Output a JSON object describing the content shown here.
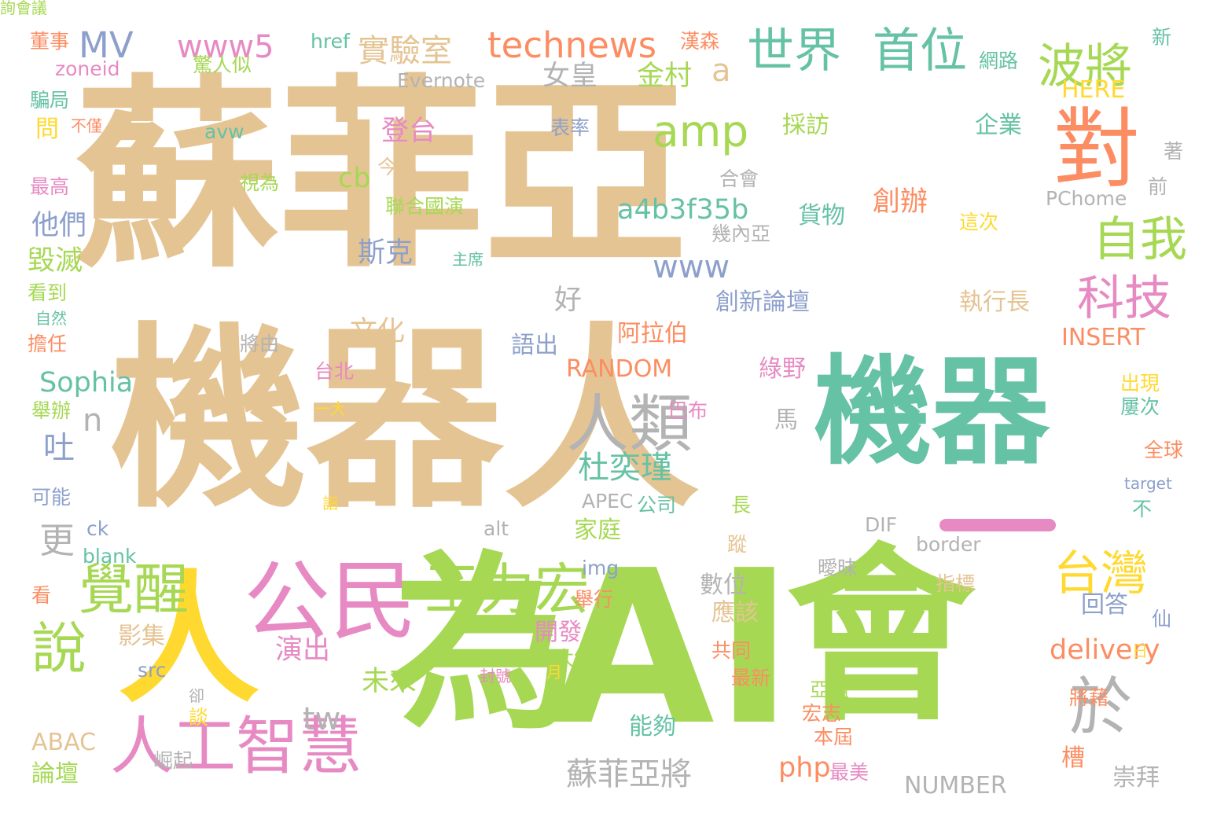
{
  "palette": {
    "tan": "#e5c494",
    "green": "#a6d854",
    "teal": "#66c2a5",
    "pink": "#e78ac3",
    "yellow": "#ffd92f",
    "grey": "#b3b3b3",
    "orange": "#fc8d62",
    "blue": "#8da0cb"
  },
  "words": [
    {
      "text": "蘇菲亞",
      "color": "tan"
    },
    {
      "text": "機器人",
      "color": "tan"
    },
    {
      "text": "機器",
      "color": "teal"
    },
    {
      "text": "AI",
      "color": "green"
    },
    {
      "text": "會",
      "color": "green"
    },
    {
      "text": "為",
      "color": "green"
    },
    {
      "text": "人",
      "color": "yellow"
    },
    {
      "text": "公民",
      "color": "pink"
    },
    {
      "text": "對",
      "color": "orange"
    },
    {
      "text": "人類",
      "color": "grey"
    },
    {
      "text": "於",
      "color": "grey"
    },
    {
      "text": "人工智慧",
      "color": "pink"
    },
    {
      "text": "王力宏",
      "color": "green"
    },
    {
      "text": "覺醒",
      "color": "green"
    },
    {
      "text": "說",
      "color": "green"
    },
    {
      "text": "世界",
      "color": "teal"
    },
    {
      "text": "首位",
      "color": "teal"
    },
    {
      "text": "波將",
      "color": "green"
    },
    {
      "text": "自我",
      "color": "green"
    },
    {
      "text": "科技",
      "color": "pink"
    },
    {
      "text": "台灣",
      "color": "yellow"
    },
    {
      "text": "amp",
      "color": "green"
    },
    {
      "text": "technews",
      "color": "orange"
    },
    {
      "text": "www5",
      "color": "pink"
    },
    {
      "text": "MV",
      "color": "blue"
    },
    {
      "text": "實驗室",
      "color": "tan"
    },
    {
      "text": "a",
      "color": "tan"
    },
    {
      "text": "www",
      "color": "blue"
    },
    {
      "text": "a4b3f35b",
      "color": "teal"
    },
    {
      "text": "創辦",
      "color": "orange"
    },
    {
      "text": "杜奕瑾",
      "color": "teal"
    },
    {
      "text": "蘇菲亞將",
      "color": "grey"
    },
    {
      "text": "登台",
      "color": "pink"
    },
    {
      "text": "演出",
      "color": "pink"
    },
    {
      "text": "未來",
      "color": "green"
    },
    {
      "text": "delivery",
      "color": "orange"
    },
    {
      "text": "php",
      "color": "orange"
    },
    {
      "text": "tw",
      "color": "grey"
    },
    {
      "text": "更",
      "color": "grey"
    },
    {
      "text": "吐",
      "color": "blue"
    },
    {
      "text": "n",
      "color": "grey"
    },
    {
      "text": "cb",
      "color": "green"
    },
    {
      "text": "他們",
      "color": "blue"
    },
    {
      "text": "斯克",
      "color": "blue"
    },
    {
      "text": "毀滅",
      "color": "green"
    },
    {
      "text": "Sophia",
      "color": "teal"
    },
    {
      "text": "文化",
      "color": "tan"
    },
    {
      "text": "好",
      "color": "grey"
    },
    {
      "text": "女皇",
      "color": "grey"
    },
    {
      "text": "金村",
      "color": "green"
    },
    {
      "text": "採訪",
      "color": "green"
    },
    {
      "text": "企業",
      "color": "teal"
    },
    {
      "text": "貨物",
      "color": "teal"
    },
    {
      "text": "執行長",
      "color": "tan"
    },
    {
      "text": "創新論壇",
      "color": "blue"
    },
    {
      "text": "INSERT",
      "color": "orange"
    },
    {
      "text": "HERE",
      "color": "yellow"
    },
    {
      "text": "RANDOM",
      "color": "orange"
    },
    {
      "text": "NUMBER",
      "color": "grey"
    },
    {
      "text": "阿拉伯",
      "color": "orange"
    },
    {
      "text": "綠野",
      "color": "pink"
    },
    {
      "text": "語出",
      "color": "blue"
    },
    {
      "text": "數位",
      "color": "grey"
    },
    {
      "text": "應該",
      "color": "tan"
    },
    {
      "text": "開發",
      "color": "pink"
    },
    {
      "text": "能夠",
      "color": "teal"
    },
    {
      "text": "家庭",
      "color": "green"
    },
    {
      "text": "影集",
      "color": "tan"
    },
    {
      "text": "可能",
      "color": "blue"
    },
    {
      "text": "看",
      "color": "orange"
    },
    {
      "text": "ABAC",
      "color": "tan"
    },
    {
      "text": "論壇",
      "color": "green"
    },
    {
      "text": "槽",
      "color": "orange"
    },
    {
      "text": "崇拜",
      "color": "grey"
    },
    {
      "text": "出現",
      "color": "yellow"
    },
    {
      "text": "屢次",
      "color": "teal"
    },
    {
      "text": "回答",
      "color": "blue"
    },
    {
      "text": "仙",
      "color": "blue"
    },
    {
      "text": "DIF",
      "color": "grey"
    },
    {
      "text": "不",
      "color": "teal"
    },
    {
      "text": "馬",
      "color": "grey"
    },
    {
      "text": "蹤",
      "color": "tan"
    },
    {
      "text": "網路",
      "color": "teal"
    },
    {
      "text": "新",
      "color": "teal"
    },
    {
      "text": "漢森",
      "color": "orange"
    },
    {
      "text": "驚人似",
      "color": "green"
    },
    {
      "text": "href",
      "color": "teal"
    },
    {
      "text": "zoneid",
      "color": "pink"
    },
    {
      "text": "董事",
      "color": "orange"
    },
    {
      "text": "Evernote",
      "color": "grey"
    },
    {
      "text": "騙局",
      "color": "teal"
    },
    {
      "text": "問",
      "color": "yellow"
    },
    {
      "text": "不僅",
      "color": "orange"
    },
    {
      "text": "avw",
      "color": "teal"
    },
    {
      "text": "表率",
      "color": "blue"
    },
    {
      "text": "最高",
      "color": "pink"
    },
    {
      "text": "今年",
      "color": "tan"
    },
    {
      "text": "視為",
      "color": "green"
    },
    {
      "text": "聯合國演",
      "color": "green"
    },
    {
      "text": "主席",
      "color": "teal"
    },
    {
      "text": "合會",
      "color": "grey"
    },
    {
      "text": "幾內亞",
      "color": "grey"
    },
    {
      "text": "這次",
      "color": "yellow"
    },
    {
      "text": "PChome",
      "color": "grey"
    },
    {
      "text": "前",
      "color": "grey"
    },
    {
      "text": "著",
      "color": "grey"
    },
    {
      "text": "擔任",
      "color": "orange"
    },
    {
      "text": "將由",
      "color": "grey"
    },
    {
      "text": "台北",
      "color": "pink"
    },
    {
      "text": "一大",
      "color": "yellow"
    },
    {
      "text": "舉辦",
      "color": "green"
    },
    {
      "text": "巴布",
      "color": "pink"
    },
    {
      "text": "target",
      "color": "blue"
    },
    {
      "text": "全球",
      "color": "orange"
    },
    {
      "text": "公司",
      "color": "teal"
    },
    {
      "text": "APEC",
      "color": "grey"
    },
    {
      "text": "長",
      "color": "green"
    },
    {
      "text": "詣",
      "color": "yellow"
    },
    {
      "text": "ck",
      "color": "blue"
    },
    {
      "text": "blank",
      "color": "teal"
    },
    {
      "text": "alt",
      "color": "grey"
    },
    {
      "text": "img",
      "color": "blue"
    },
    {
      "text": "border",
      "color": "grey"
    },
    {
      "text": "曖昧",
      "color": "grey"
    },
    {
      "text": "指標",
      "color": "tan"
    },
    {
      "text": "舉行",
      "color": "orange"
    },
    {
      "text": "亞太經",
      "color": "green"
    },
    {
      "text": "共同",
      "color": "orange"
    },
    {
      "text": "最新",
      "color": "orange"
    },
    {
      "text": "src",
      "color": "blue"
    },
    {
      "text": "封號",
      "color": "pink"
    },
    {
      "text": "亞組",
      "color": "green"
    },
    {
      "text": "宏志",
      "color": "orange"
    },
    {
      "text": "本屆",
      "color": "orange"
    },
    {
      "text": "最美",
      "color": "pink"
    },
    {
      "text": "談",
      "color": "yellow"
    },
    {
      "text": "崛起",
      "color": "grey"
    },
    {
      "text": "將藉",
      "color": "orange"
    },
    {
      "text": "日",
      "color": "yellow"
    },
    {
      "text": "月",
      "color": "yellow"
    },
    {
      "text": "卻",
      "color": "grey"
    },
    {
      "text": "自然",
      "color": "teal"
    },
    {
      "text": "看到",
      "color": "green"
    },
    {
      "text": "詢會議",
      "color": "green"
    }
  ]
}
